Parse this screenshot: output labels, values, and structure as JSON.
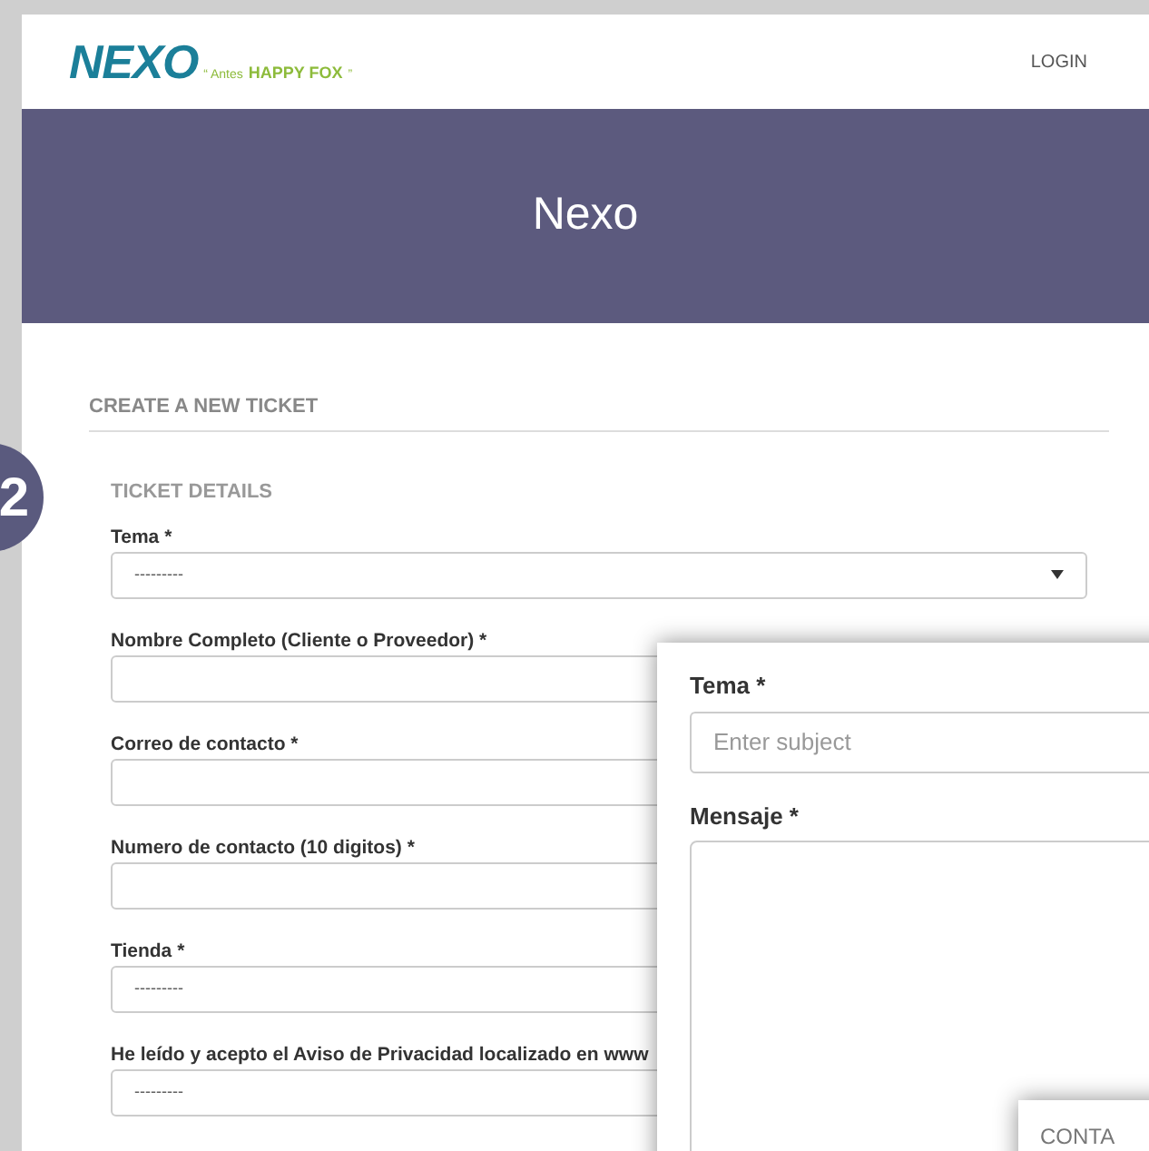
{
  "header": {
    "logo": {
      "name": "NEXO",
      "tag_prefix": "“ Antes",
      "tag_brand": "HAPPY FOX",
      "tag_suffix": "”"
    },
    "nav": [
      {
        "label": "LOGIN"
      }
    ]
  },
  "banner": {
    "title": "Nexo"
  },
  "step_badge": "2",
  "form": {
    "title": "CREATE A NEW TICKET",
    "section": "TICKET DETAILS",
    "fields": [
      {
        "kind": "select",
        "label": "Tema *",
        "value": "---------"
      },
      {
        "kind": "text",
        "label": "Nombre Completo (Cliente o Proveedor) *"
      },
      {
        "kind": "text",
        "label": "Correo de contacto *"
      },
      {
        "kind": "text",
        "label": "Numero de contacto (10 digitos) *"
      },
      {
        "kind": "select",
        "label": "Tienda *",
        "value": "---------"
      },
      {
        "kind": "select",
        "label": "He leído y acepto el Aviso de Privacidad localizado en www",
        "value": "---------"
      }
    ]
  },
  "callout": {
    "fields": [
      {
        "kind": "text",
        "label": "Tema *",
        "placeholder": "Enter subject"
      },
      {
        "kind": "textarea",
        "label": "Mensaje *"
      }
    ]
  },
  "callout_2": {
    "title": "CONTA"
  }
}
